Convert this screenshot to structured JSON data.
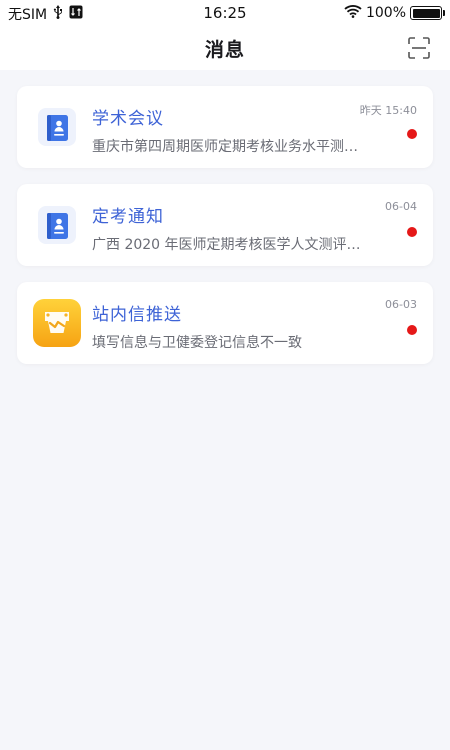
{
  "status_bar": {
    "carrier": "无SIM",
    "time": "16:25",
    "battery": "100%",
    "icons": [
      "usb-icon",
      "data-icon",
      "wifi-icon",
      "battery-icon"
    ]
  },
  "nav": {
    "title": "消息",
    "right_icon": "scan-icon"
  },
  "messages": [
    {
      "title": "学术会议",
      "time": "昨天 15:40",
      "preview": "重庆市第四周期医师定期考核业务水平测…",
      "icon": "document-icon",
      "unread": true
    },
    {
      "title": "定考通知",
      "time": "06-04",
      "preview": "广西 2020 年医师定期考核医学人文测评…",
      "icon": "document-icon",
      "unread": true
    },
    {
      "title": "站内信推送",
      "time": "06-03",
      "preview": "填写信息与卫健委登记信息不一致",
      "icon": "inbox-icon",
      "unread": true
    }
  ],
  "colors": {
    "title_blue": "#3e63d6",
    "unread_red": "#e51818",
    "background": "#f5f6fa"
  }
}
